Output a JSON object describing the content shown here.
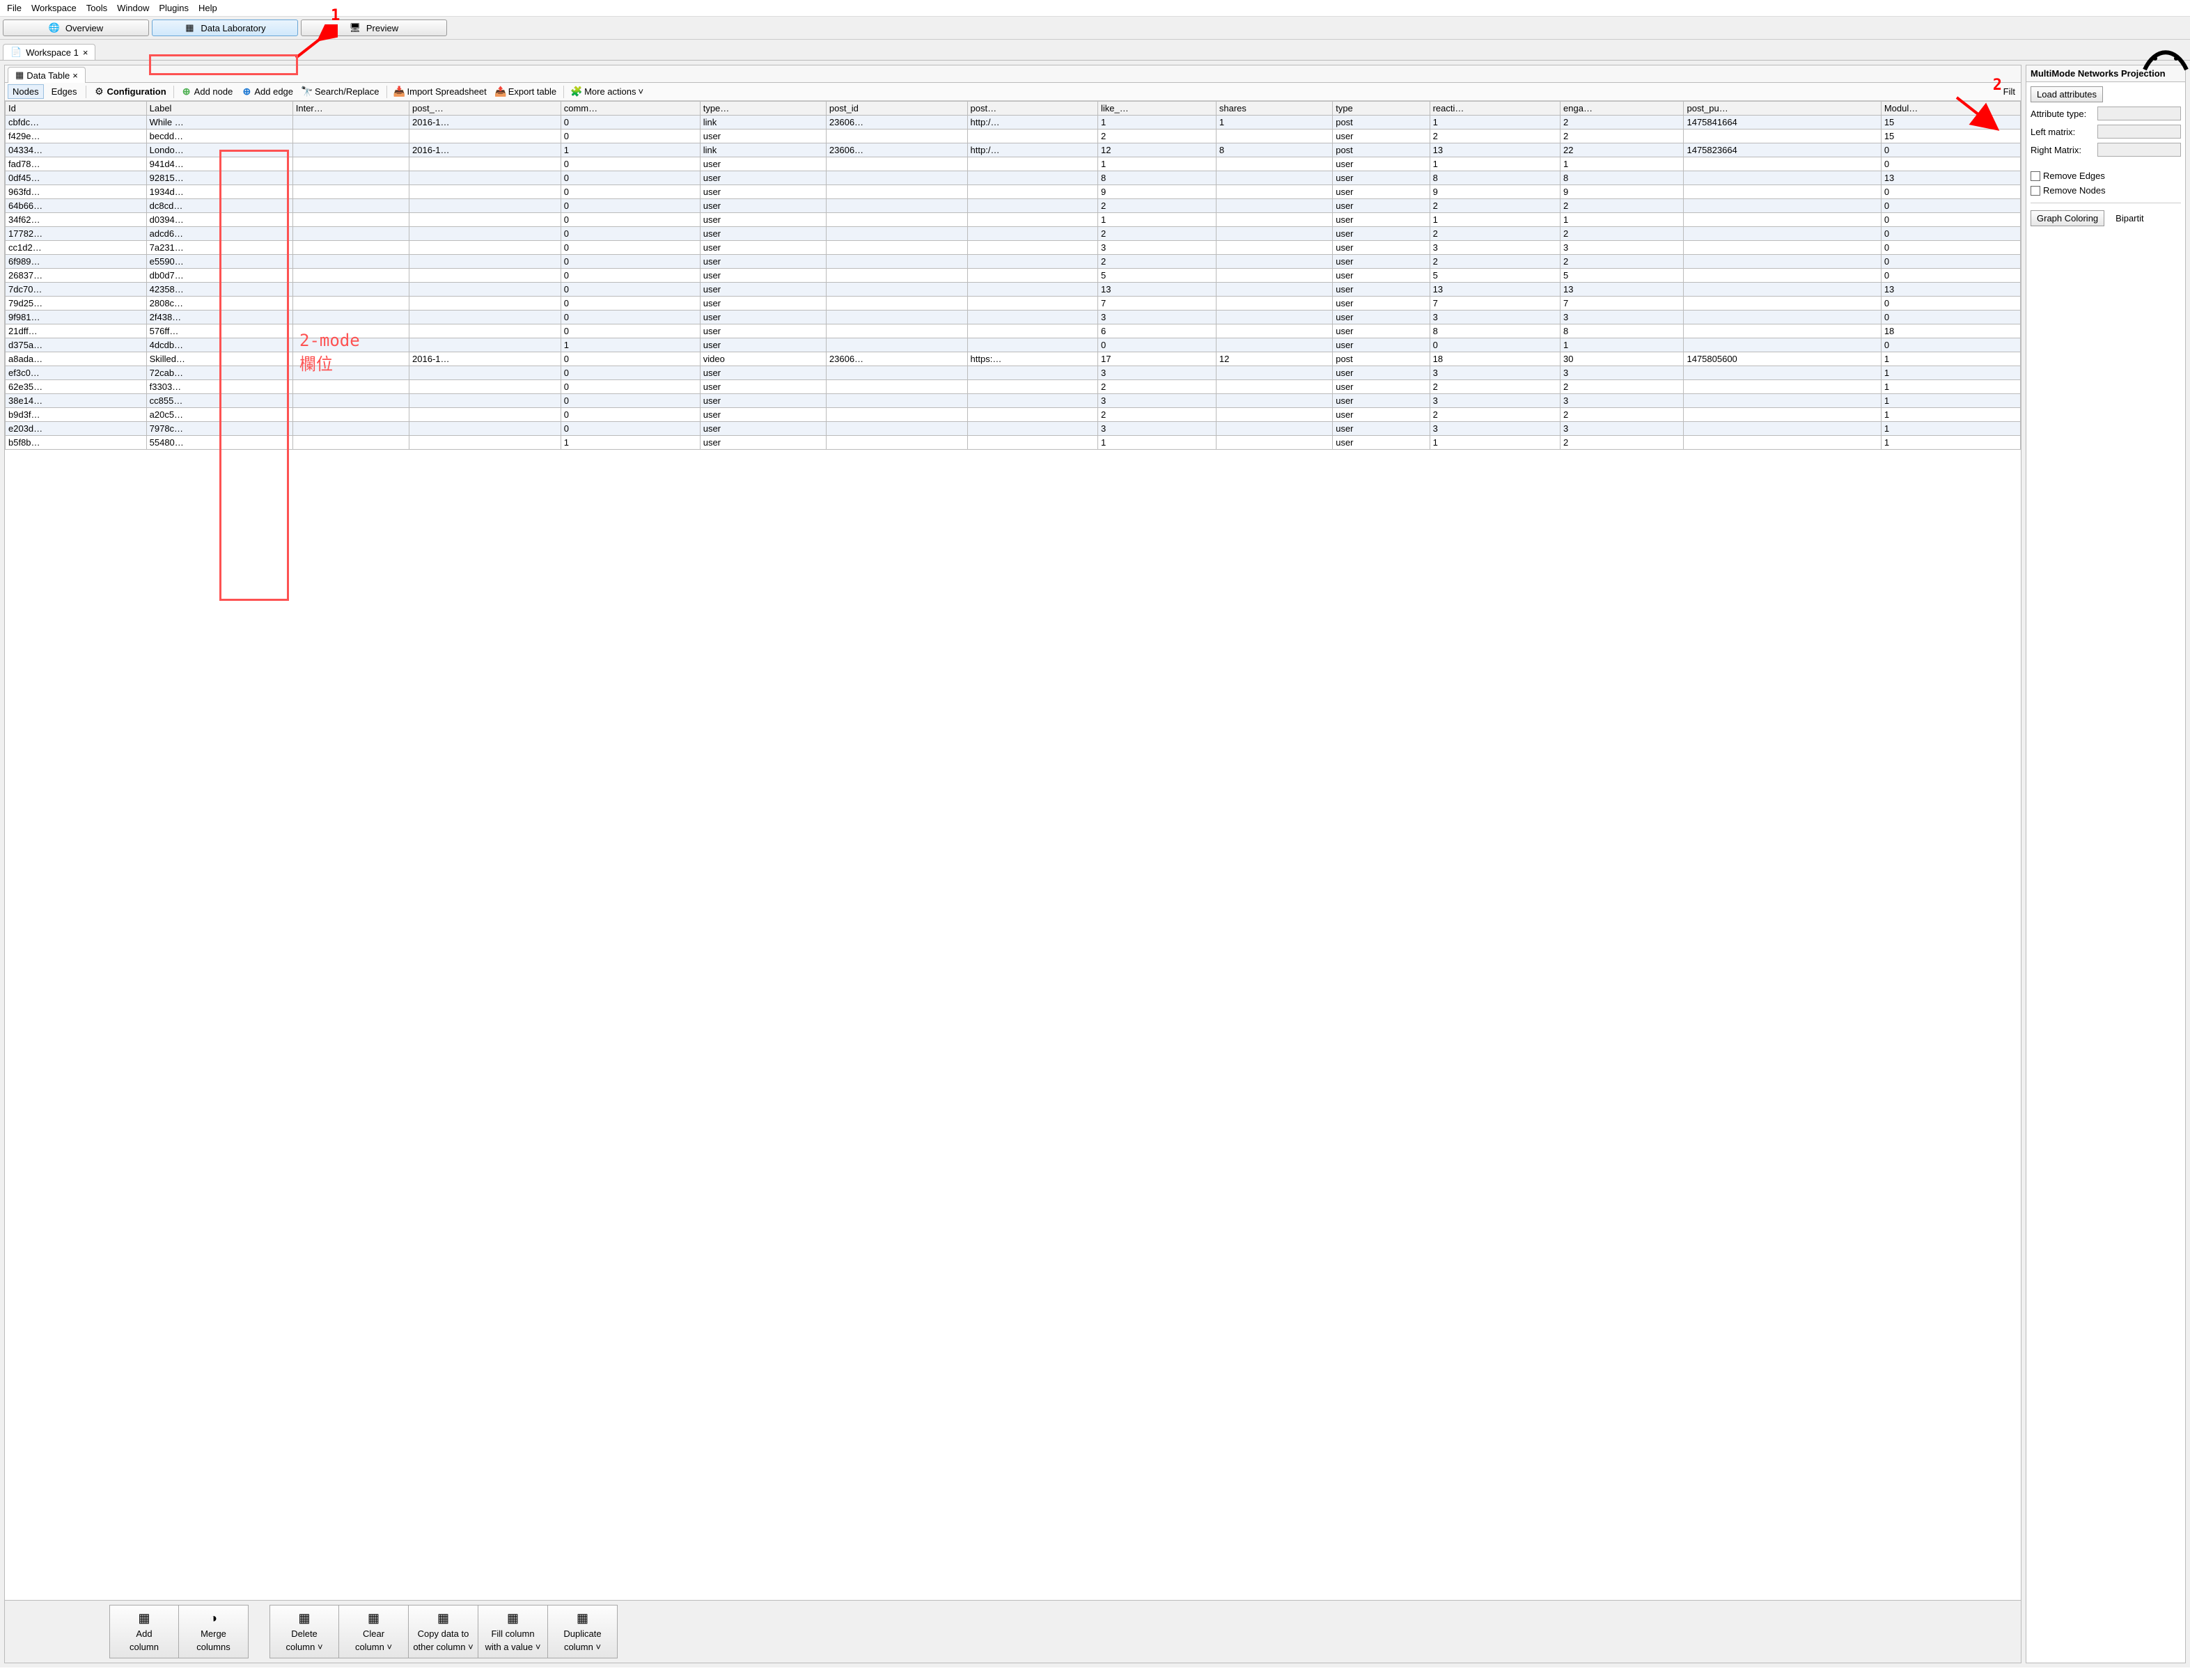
{
  "menu": [
    "File",
    "Workspace",
    "Tools",
    "Window",
    "Plugins",
    "Help"
  ],
  "mainTabs": [
    {
      "label": "Overview",
      "icon": "globe"
    },
    {
      "label": "Data Laboratory",
      "icon": "table",
      "active": true
    },
    {
      "label": "Preview",
      "icon": "monitor"
    }
  ],
  "workspaceTab": "Workspace 1",
  "subTab": "Data Table",
  "tableToolbar": {
    "nodes": "Nodes",
    "edges": "Edges",
    "config": "Configuration",
    "addNode": "Add node",
    "addEdge": "Add edge",
    "search": "Search/Replace",
    "import": "Import Spreadsheet",
    "export": "Export table",
    "more": "More actions",
    "filter": "Filt"
  },
  "columns": [
    "Id",
    "Label",
    "Inter…",
    "post_…",
    "comm…",
    "type…",
    "post_id",
    "post…",
    "like_…",
    "shares",
    "type",
    "reacti…",
    "enga…",
    "post_pu…",
    "Modul…"
  ],
  "rows": [
    [
      "cbfdc…",
      "While …",
      "",
      "2016-1…",
      "0",
      "link",
      "23606…",
      "http:/…",
      "1",
      "1",
      "post",
      "1",
      "2",
      "1475841664",
      "15"
    ],
    [
      "f429e…",
      "becdd…",
      "",
      "",
      "0",
      "user",
      "",
      "",
      "2",
      "",
      "user",
      "2",
      "2",
      "",
      "15"
    ],
    [
      "04334…",
      "Londo…",
      "",
      "2016-1…",
      "1",
      "link",
      "23606…",
      "http:/…",
      "12",
      "8",
      "post",
      "13",
      "22",
      "1475823664",
      "0"
    ],
    [
      "fad78…",
      "941d4…",
      "",
      "",
      "0",
      "user",
      "",
      "",
      "1",
      "",
      "user",
      "1",
      "1",
      "",
      "0"
    ],
    [
      "0df45…",
      "92815…",
      "",
      "",
      "0",
      "user",
      "",
      "",
      "8",
      "",
      "user",
      "8",
      "8",
      "",
      "13"
    ],
    [
      "963fd…",
      "1934d…",
      "",
      "",
      "0",
      "user",
      "",
      "",
      "9",
      "",
      "user",
      "9",
      "9",
      "",
      "0"
    ],
    [
      "64b66…",
      "dc8cd…",
      "",
      "",
      "0",
      "user",
      "",
      "",
      "2",
      "",
      "user",
      "2",
      "2",
      "",
      "0"
    ],
    [
      "34f62…",
      "d0394…",
      "",
      "",
      "0",
      "user",
      "",
      "",
      "1",
      "",
      "user",
      "1",
      "1",
      "",
      "0"
    ],
    [
      "17782…",
      "adcd6…",
      "",
      "",
      "0",
      "user",
      "",
      "",
      "2",
      "",
      "user",
      "2",
      "2",
      "",
      "0"
    ],
    [
      "cc1d2…",
      "7a231…",
      "",
      "",
      "0",
      "user",
      "",
      "",
      "3",
      "",
      "user",
      "3",
      "3",
      "",
      "0"
    ],
    [
      "6f989…",
      "e5590…",
      "",
      "",
      "0",
      "user",
      "",
      "",
      "2",
      "",
      "user",
      "2",
      "2",
      "",
      "0"
    ],
    [
      "26837…",
      "db0d7…",
      "",
      "",
      "0",
      "user",
      "",
      "",
      "5",
      "",
      "user",
      "5",
      "5",
      "",
      "0"
    ],
    [
      "7dc70…",
      "42358…",
      "",
      "",
      "0",
      "user",
      "",
      "",
      "13",
      "",
      "user",
      "13",
      "13",
      "",
      "13"
    ],
    [
      "79d25…",
      "2808c…",
      "",
      "",
      "0",
      "user",
      "",
      "",
      "7",
      "",
      "user",
      "7",
      "7",
      "",
      "0"
    ],
    [
      "9f981…",
      "2f438…",
      "",
      "",
      "0",
      "user",
      "",
      "",
      "3",
      "",
      "user",
      "3",
      "3",
      "",
      "0"
    ],
    [
      "21dff…",
      "576ff…",
      "",
      "",
      "0",
      "user",
      "",
      "",
      "6",
      "",
      "user",
      "8",
      "8",
      "",
      "18"
    ],
    [
      "d375a…",
      "4dcdb…",
      "",
      "",
      "1",
      "user",
      "",
      "",
      "0",
      "",
      "user",
      "0",
      "1",
      "",
      "0"
    ],
    [
      "a8ada…",
      "Skilled…",
      "",
      "2016-1…",
      "0",
      "video",
      "23606…",
      "https:…",
      "17",
      "12",
      "post",
      "18",
      "30",
      "1475805600",
      "1"
    ],
    [
      "ef3c0…",
      "72cab…",
      "",
      "",
      "0",
      "user",
      "",
      "",
      "3",
      "",
      "user",
      "3",
      "3",
      "",
      "1"
    ],
    [
      "62e35…",
      "f3303…",
      "",
      "",
      "0",
      "user",
      "",
      "",
      "2",
      "",
      "user",
      "2",
      "2",
      "",
      "1"
    ],
    [
      "38e14…",
      "cc855…",
      "",
      "",
      "0",
      "user",
      "",
      "",
      "3",
      "",
      "user",
      "3",
      "3",
      "",
      "1"
    ],
    [
      "b9d3f…",
      "a20c5…",
      "",
      "",
      "0",
      "user",
      "",
      "",
      "2",
      "",
      "user",
      "2",
      "2",
      "",
      "1"
    ],
    [
      "e203d…",
      "7978c…",
      "",
      "",
      "0",
      "user",
      "",
      "",
      "3",
      "",
      "user",
      "3",
      "3",
      "",
      "1"
    ],
    [
      "b5f8b…",
      "55480…",
      "",
      "",
      "1",
      "user",
      "",
      "",
      "1",
      "",
      "user",
      "1",
      "2",
      "",
      "1"
    ]
  ],
  "colOps": [
    {
      "label1": "Add",
      "label2": "column",
      "icon": "col-add"
    },
    {
      "label1": "Merge",
      "label2": "columns",
      "icon": "col-merge"
    },
    {
      "gap": true
    },
    {
      "label1": "Delete",
      "label2": "column ˅",
      "icon": "col-del"
    },
    {
      "label1": "Clear",
      "label2": "column ˅",
      "icon": "col-clear"
    },
    {
      "label1": "Copy data to",
      "label2": "other column ˅",
      "icon": "col-copy"
    },
    {
      "label1": "Fill column",
      "label2": "with a value ˅",
      "icon": "col-fill"
    },
    {
      "label1": "Duplicate",
      "label2": "column ˅",
      "icon": "col-dup"
    }
  ],
  "rightPanel": {
    "title": "MultiMode Networks Projection",
    "loadBtn": "Load attributes",
    "attrType": "Attribute type:",
    "leftMatrix": "Left matrix:",
    "rightMatrix": "Right Matrix:",
    "removeEdges": "Remove Edges",
    "removeNodes": "Remove Nodes",
    "graphColoring": "Graph Coloring",
    "bipartite": "Bipartit"
  },
  "annotations": {
    "num1": "1",
    "num2": "2",
    "modeText1": "2-mode",
    "modeText2": "欄位"
  }
}
